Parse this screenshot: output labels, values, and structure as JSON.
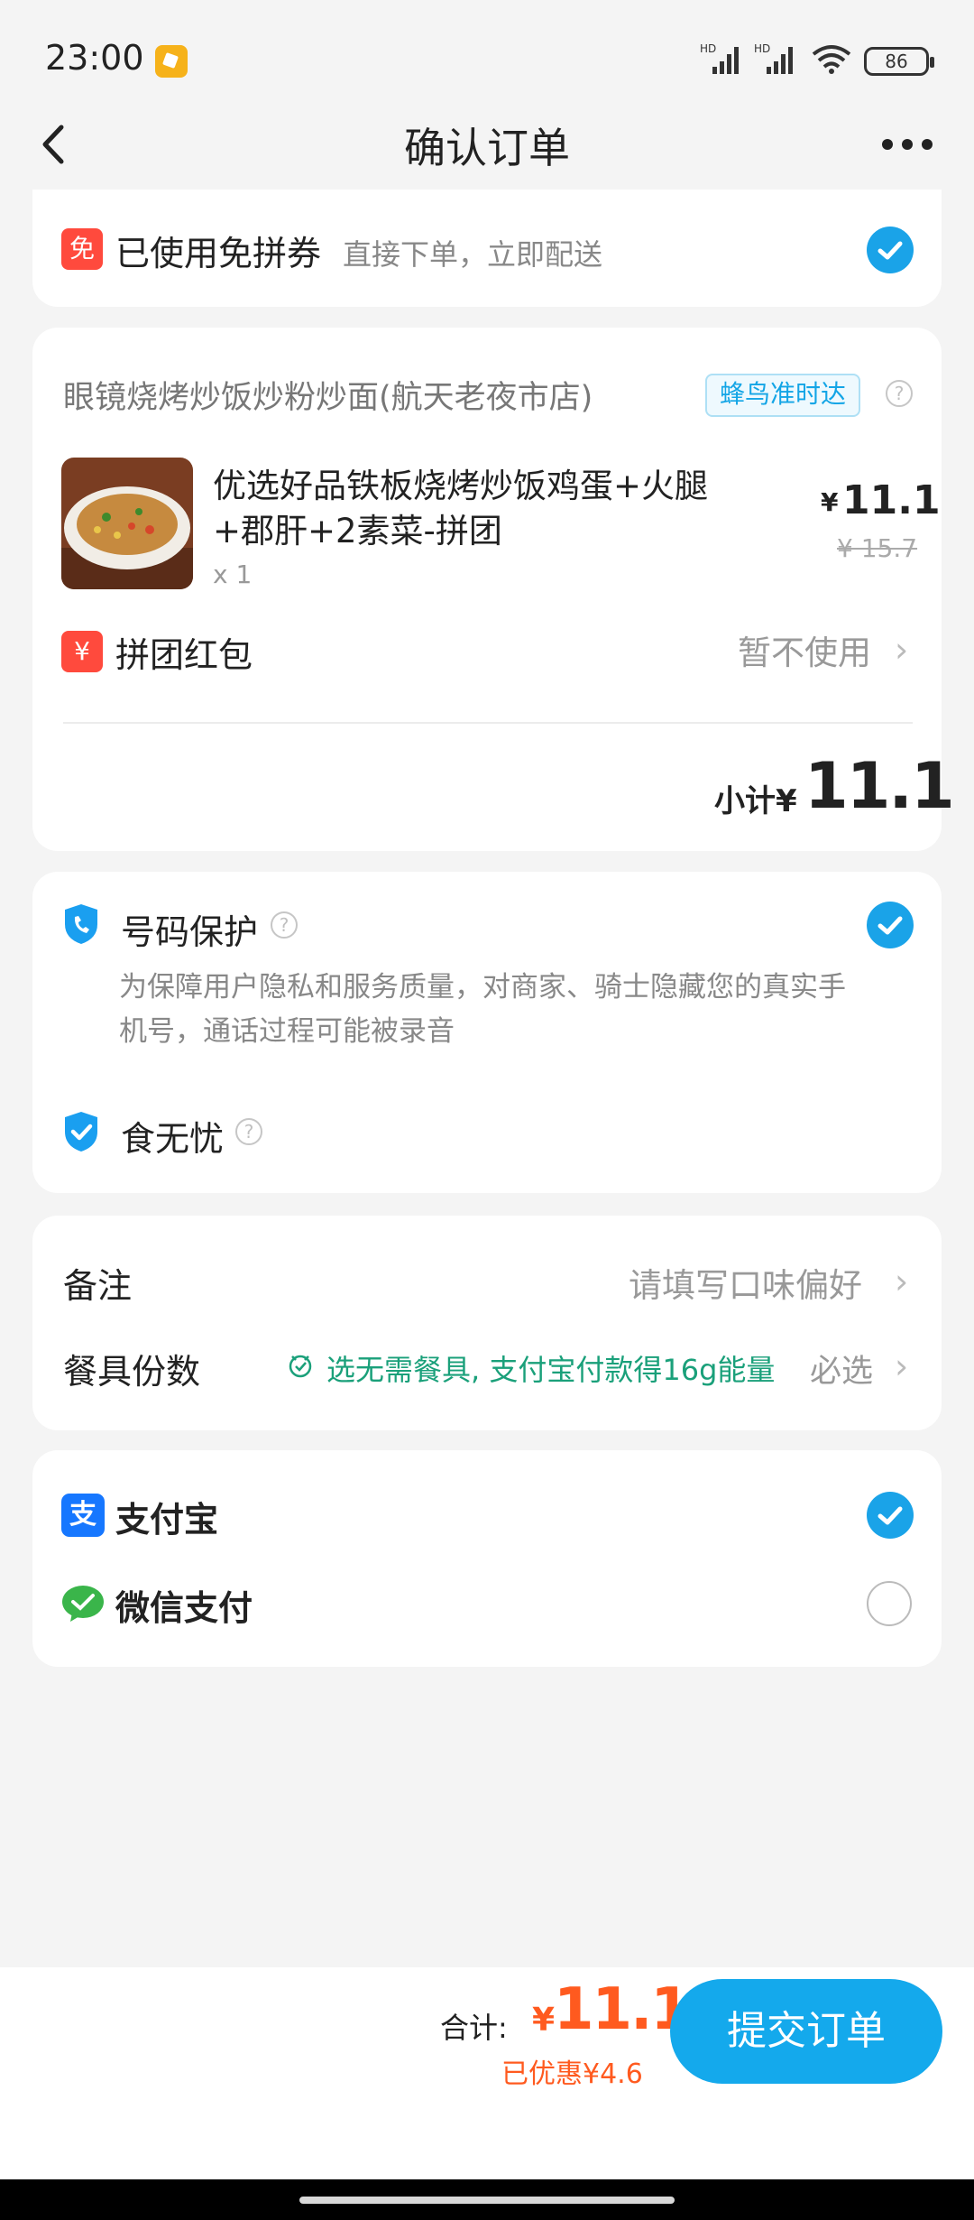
{
  "status_bar": {
    "time": "23:00",
    "battery": "86",
    "hd1": "HD",
    "hd2": "HD"
  },
  "nav": {
    "title": "确认订单"
  },
  "coupon": {
    "badge": "免",
    "title": "已使用免拼券",
    "desc": "直接下单，立即配送"
  },
  "store": {
    "name": "眼镜烧烤炒饭炒粉炒面(航天老夜市店)",
    "delivery_tag": "蜂鸟准时达",
    "item": {
      "name_line1": "优选好品铁板烧烤炒饭鸡蛋+火腿",
      "name_line2": "+郡肝+2素菜-拼团",
      "qty": "x 1",
      "price": "11.1",
      "currency": "¥",
      "original_price": "¥ 15.7"
    },
    "red_packet": {
      "badge": "¥",
      "label": "拼团红包",
      "value": "暂不使用"
    },
    "subtotal_label": "小计¥",
    "subtotal_value": "11.1"
  },
  "services": {
    "number_protection": {
      "title": "号码保护",
      "desc_line1": "为保障用户隐私和服务质量，对商家、骑士隐藏您的真实手",
      "desc_line2": "机号，通话过程可能被录音"
    },
    "food_safety": {
      "title": "食无忧"
    }
  },
  "notes": {
    "remark_label": "备注",
    "remark_placeholder": "请填写口味偏好",
    "utensils_label": "餐具份数",
    "utensils_promo": "选无需餐具, 支付宝付款得16g能量",
    "utensils_required": "必选"
  },
  "payment": {
    "alipay": {
      "label": "支付宝",
      "icon_char": "支"
    },
    "wechat": {
      "label": "微信支付"
    }
  },
  "footer": {
    "total_label": "合计:",
    "currency": "¥",
    "total_value": "11.1",
    "discount": "已优惠¥4.6",
    "submit_label": "提交订单"
  },
  "colors": {
    "accent": "#14a9ec",
    "price_red": "#ff5a1f",
    "badge_red": "#ff4a3d",
    "promo_green": "#1aa07a",
    "wechat_green": "#3ab54a",
    "alipay_blue": "#1677ff"
  }
}
